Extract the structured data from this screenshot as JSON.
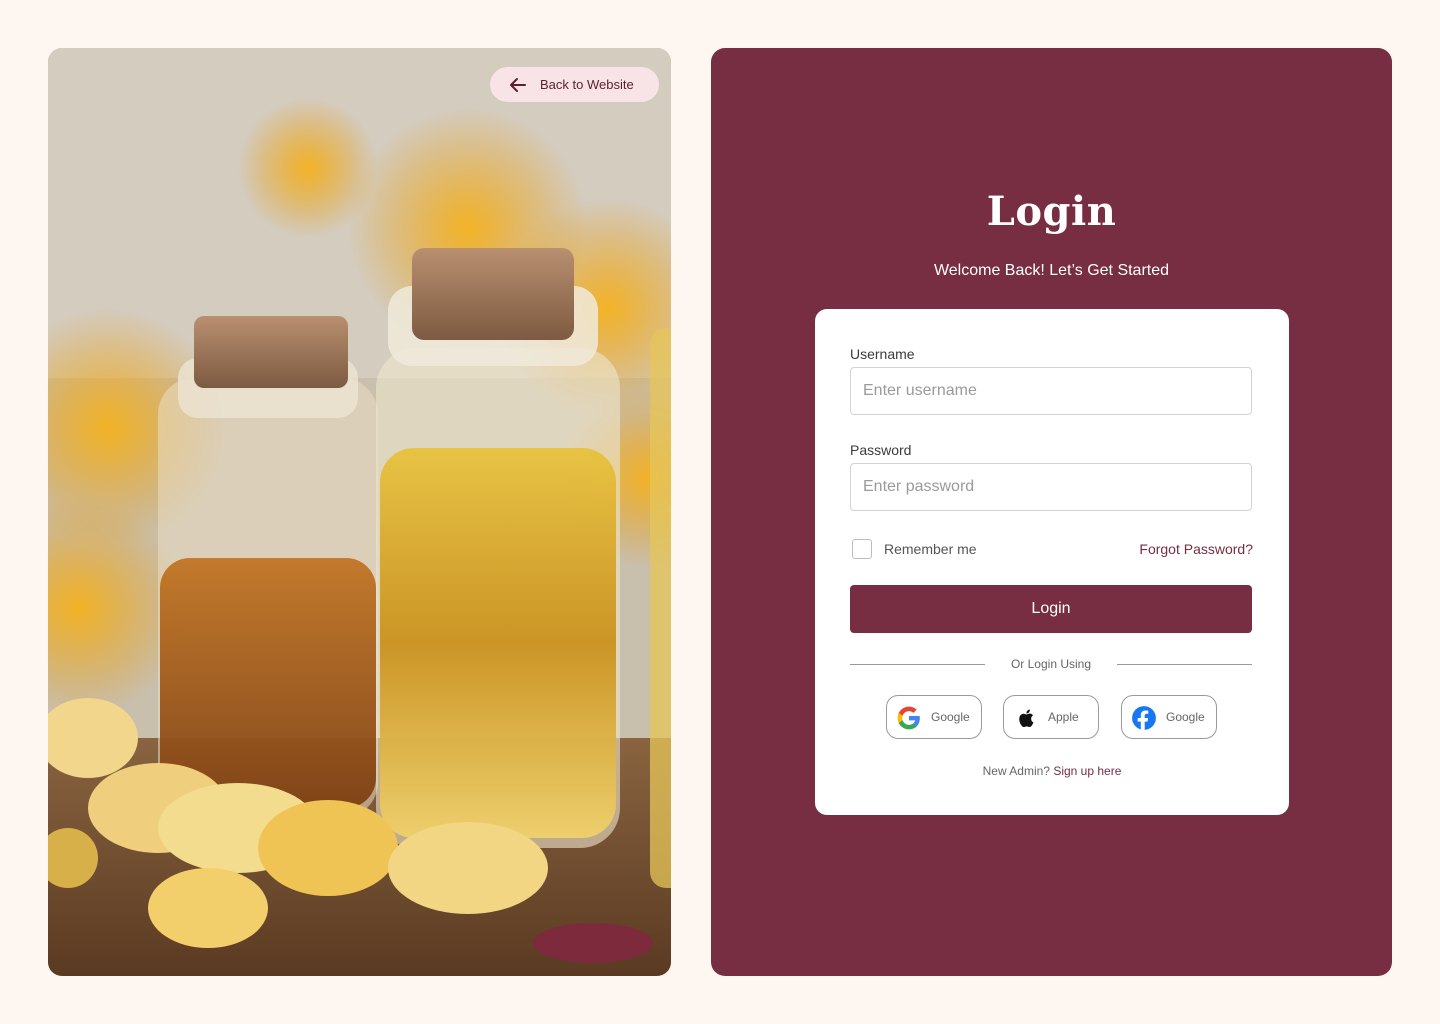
{
  "back_link": {
    "label": "Back to Website",
    "icon": "arrow-left-icon"
  },
  "colors": {
    "brand": "#772d42",
    "page_background": "#fdf6f1",
    "back_button_bg": "#f8e3e6"
  },
  "login": {
    "title": "Login",
    "subtitle": "Welcome Back! Let’s Get Started",
    "username_label": "Username",
    "username_placeholder": "Enter username",
    "username_value": "",
    "password_label": "Password",
    "password_placeholder": "Enter password",
    "password_value": "",
    "remember_label": "Remember me",
    "remember_checked": false,
    "forgot_label": "Forgot Password?",
    "submit_label": "Login",
    "divider_text": "Or Login Using",
    "social": [
      {
        "label": "Google",
        "icon": "google-icon"
      },
      {
        "label": "Apple",
        "icon": "apple-icon"
      },
      {
        "label": "Google",
        "icon": "facebook-icon"
      }
    ],
    "signup_prompt": "New Admin?",
    "signup_link": "Sign up here"
  }
}
